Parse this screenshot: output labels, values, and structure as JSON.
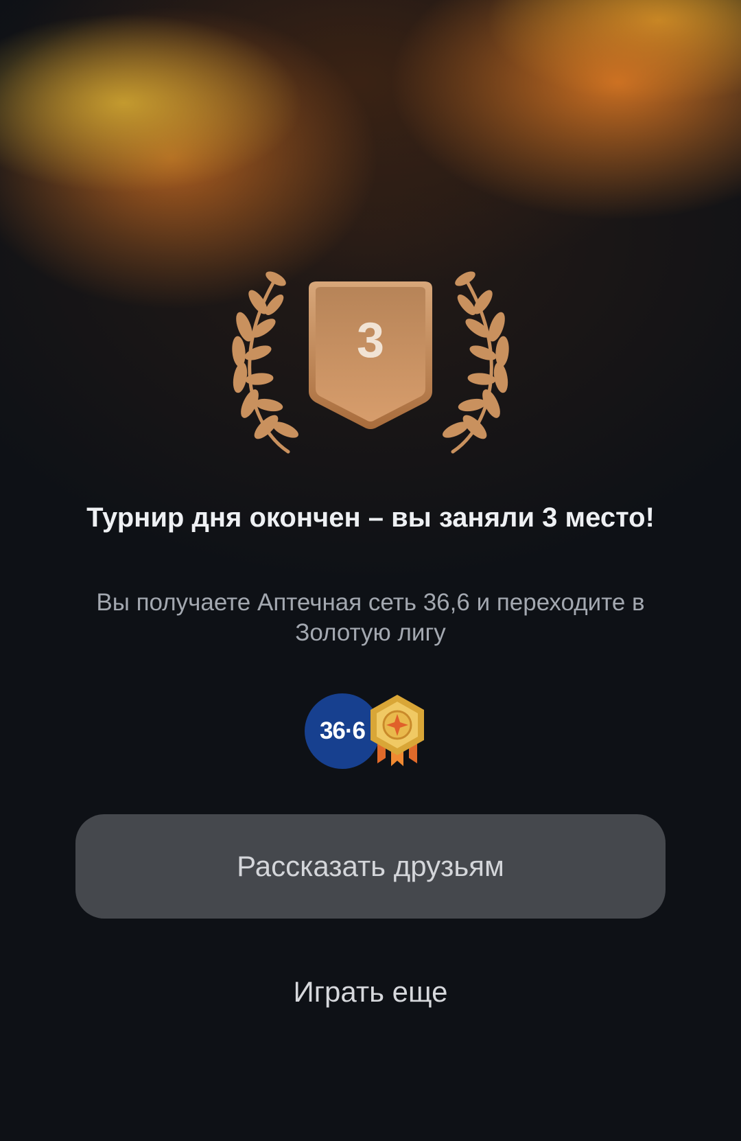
{
  "result": {
    "place": "3",
    "title": "Турнир дня окончен – вы заняли 3 место!",
    "subtitle": "Вы получаете Аптечная сеть 36,6 и переходите в Золотую лигу"
  },
  "rewards": {
    "pharmacy_logo_text": "36·6"
  },
  "actions": {
    "share_label": "Рассказать друзьям",
    "play_again_label": "Играть еще"
  },
  "colors": {
    "background": "#0e1116",
    "bronze": "#c9915e",
    "pharmacy_blue": "#17408f",
    "button": "#45484d"
  }
}
